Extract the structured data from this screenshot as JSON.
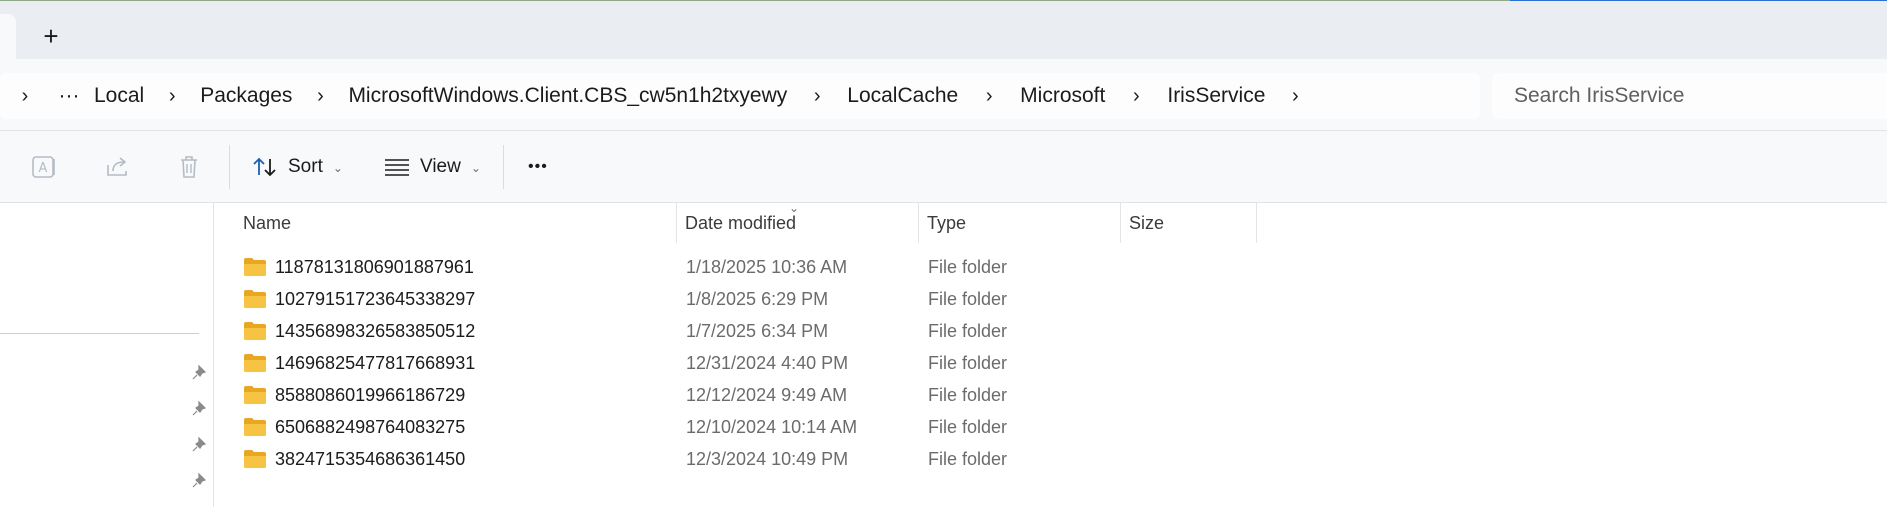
{
  "tabstrip": {
    "new_tab_label": "+"
  },
  "address": {
    "crumbs": [
      "Local",
      "Packages",
      "MicrosoftWindows.Client.CBS_cw5n1h2txyewy",
      "LocalCache",
      "Microsoft",
      "IrisService"
    ],
    "overflow": "···"
  },
  "search": {
    "placeholder": "Search IrisService"
  },
  "toolbar": {
    "sort_label": "Sort",
    "view_label": "View",
    "more_label": "•••"
  },
  "columns": {
    "name": "Name",
    "date": "Date modified",
    "type": "Type",
    "size": "Size"
  },
  "files": [
    {
      "name": "11878131806901887961",
      "date": "1/18/2025 10:36 AM",
      "type": "File folder"
    },
    {
      "name": "10279151723645338297",
      "date": "1/8/2025 6:29 PM",
      "type": "File folder"
    },
    {
      "name": "14356898326583850512",
      "date": "1/7/2025 6:34 PM",
      "type": "File folder"
    },
    {
      "name": "14696825477817668931",
      "date": "12/31/2024 4:40 PM",
      "type": "File folder"
    },
    {
      "name": "8588086019966186729",
      "date": "12/12/2024 9:49 AM",
      "type": "File folder"
    },
    {
      "name": "6506882498764083275",
      "date": "12/10/2024 10:14 AM",
      "type": "File folder"
    },
    {
      "name": "3824715354686361450",
      "date": "12/3/2024 10:49 PM",
      "type": "File folder"
    }
  ],
  "colors": {
    "folder": "#f6c342",
    "accent": "#0b57d0"
  }
}
